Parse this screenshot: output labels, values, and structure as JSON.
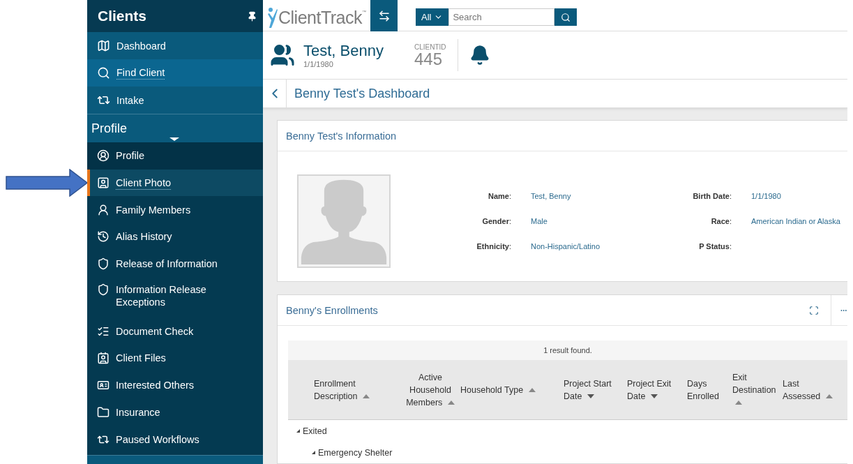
{
  "sidebar": {
    "title": "Clients",
    "nav": [
      {
        "label": "Dashboard",
        "selected": false
      },
      {
        "label": "Find Client",
        "selected": true
      },
      {
        "label": "Intake",
        "selected": false
      }
    ],
    "section": {
      "title": "Profile",
      "expanded": true,
      "items": [
        {
          "label": "Profile",
          "selected": false
        },
        {
          "label": "Client Photo",
          "selected": true
        },
        {
          "label": "Family Members",
          "selected": false
        },
        {
          "label": "Alias History",
          "selected": false
        },
        {
          "label": "Release of Information",
          "selected": false
        },
        {
          "label": "Information Release Exceptions",
          "selected": false
        },
        {
          "label": "Document Check",
          "selected": false
        },
        {
          "label": "Client Files",
          "selected": false
        },
        {
          "label": "Interested Others",
          "selected": false
        },
        {
          "label": "Insurance",
          "selected": false
        },
        {
          "label": "Paused Workflows",
          "selected": false
        }
      ]
    }
  },
  "topbar": {
    "logo": {
      "text": "ClientTrack",
      "mark": "™"
    },
    "search": {
      "scope": "All",
      "placeholder": "Search"
    }
  },
  "client": {
    "name": "Test, Benny",
    "dob": "1/1/1980",
    "id_label": "CLIENTID",
    "id": "445"
  },
  "breadcrumb": {
    "title": "Benny Test's Dashboard"
  },
  "info_card": {
    "title": "Benny Test's Information",
    "photo": {
      "kind": "placeholder"
    },
    "fields": [
      {
        "label": "**Name**:",
        "value": "Test, Benny"
      },
      {
        "label": "**Birth Date**:",
        "value": "1/1/1980"
      },
      {
        "label": "**Gender**:",
        "value": "Male"
      },
      {
        "label": "**Race**:",
        "value": "American Indian or Alaska"
      },
      {
        "label": "**Ethnicity**:",
        "value": "Non-Hispanic/Latino"
      },
      {
        "label": "**P Status**:"
      }
    ]
  },
  "enrollments": {
    "title": "Benny's Enrollments",
    "result": "1 result found.",
    "columns": [
      {
        "label": "Enrollment Description",
        "sortable": true,
        "ascending": true
      },
      {
        "label": "Active Household Members",
        "sortable": true,
        "ascending": true
      },
      {
        "label": "Household Type",
        "sortable": true,
        "ascending": true
      },
      {
        "label": "Project Start Date",
        "sortable": true,
        "ascending": false
      },
      {
        "label": "Project Exit Date",
        "sortable": true,
        "ascending": false
      },
      {
        "label": "Days Enrolled",
        "sortable": false
      },
      {
        "label": "Exit Destination",
        "sortable": true,
        "ascending": true
      },
      {
        "label": "Last Assessed",
        "sortable": true,
        "ascending": true
      }
    ],
    "groups": [
      {
        "label": "Exited",
        "expanded": true,
        "children": [
          {
            "label": "Emergency Shelter",
            "expanded": true
          }
        ]
      }
    ]
  }
}
